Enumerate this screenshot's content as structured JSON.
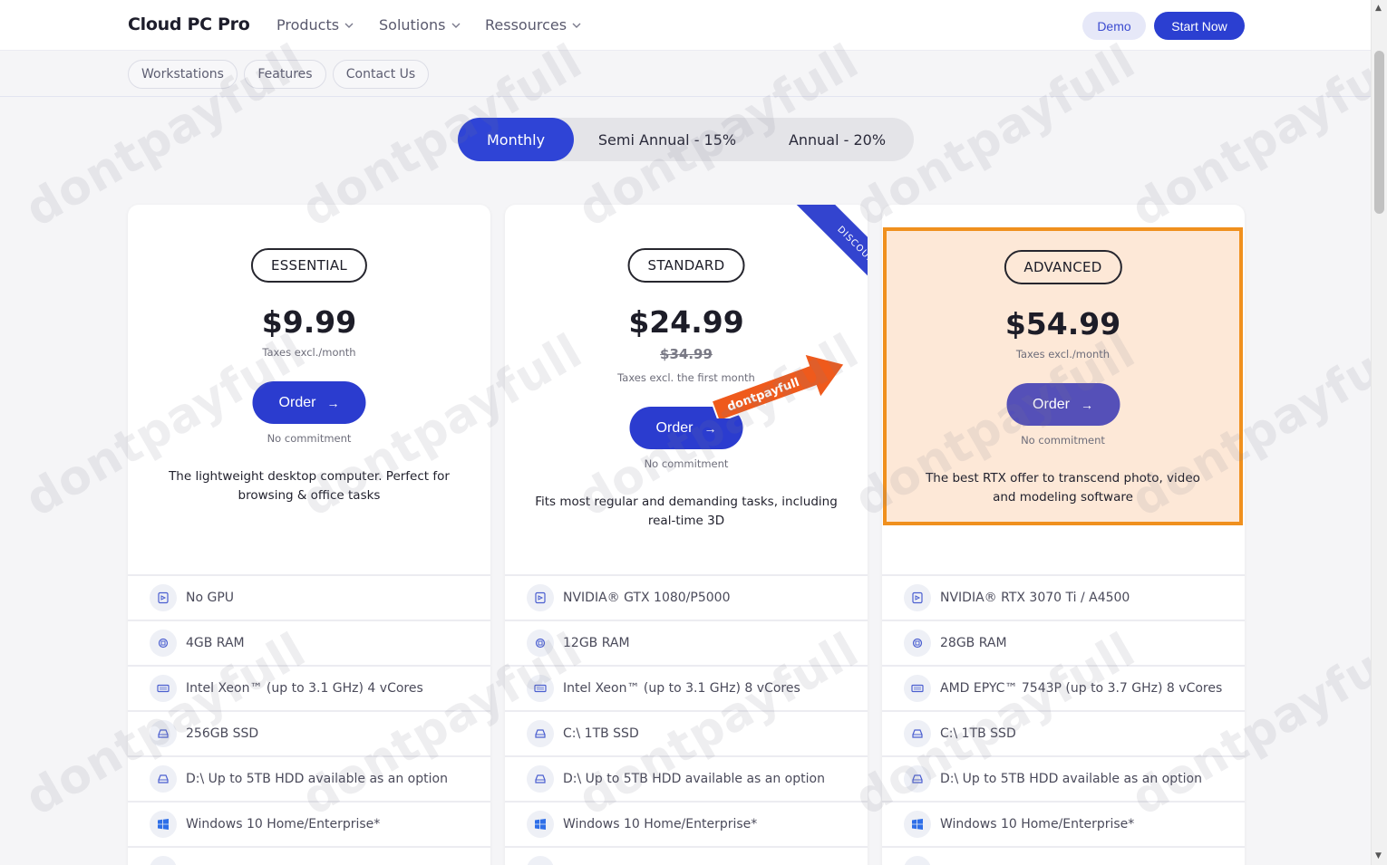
{
  "header": {
    "brand": "Cloud PC Pro",
    "nav": [
      "Products",
      "Solutions",
      "Ressources"
    ],
    "demo_label": "Demo",
    "start_label": "Start Now"
  },
  "subnav": [
    "Workstations",
    "Features",
    "Contact Us"
  ],
  "billing": {
    "options": [
      "Monthly",
      "Semi Annual - 15%",
      "Annual - 20%"
    ],
    "selected": "Monthly"
  },
  "plans": [
    {
      "name": "ESSENTIAL",
      "price": "$9.99",
      "taxes": "Taxes excl./month",
      "order_label": "Order",
      "commitment": "No commitment",
      "description": "The lightweight desktop computer. Perfect for browsing & office tasks",
      "features": [
        "No GPU",
        "4GB RAM",
        "Intel Xeon™ (up to 3.1 GHz) 4 vCores",
        "256GB SSD",
        "D:\\ Up to 5TB HDD available as an option",
        "Windows 10 Home/Enterprise*"
      ]
    },
    {
      "name": "STANDARD",
      "price": "$24.99",
      "old_price": "$34.99",
      "taxes": "Taxes excl. the first month",
      "ribbon": "DISCOUNT",
      "order_label": "Order",
      "commitment": "No commitment",
      "description": "Fits most regular and demanding tasks, including real-time 3D",
      "features": [
        "NVIDIA® GTX 1080/P5000",
        "12GB RAM",
        "Intel Xeon™ (up to 3.1 GHz) 8 vCores",
        "C:\\ 1TB SSD",
        "D:\\ Up to 5TB HDD available as an option",
        "Windows 10 Home/Enterprise*"
      ]
    },
    {
      "name": "ADVANCED",
      "price": "$54.99",
      "taxes": "Taxes excl./month",
      "order_label": "Order",
      "commitment": "No commitment",
      "description": "The best RTX offer to transcend photo, video and modeling software",
      "features": [
        "NVIDIA® RTX 3070 Ti / A4500",
        "28GB RAM",
        "AMD EPYC™ 7543P (up to 3.7 GHz) 8 vCores",
        "C:\\ 1TB SSD",
        "D:\\ Up to 5TB HDD available as an option",
        "Windows 10 Home/Enterprise*"
      ]
    }
  ],
  "overlay": {
    "arrow_text": "dontpayfull",
    "watermark": "dontpayfull"
  },
  "colors": {
    "accent": "#2b3ccf",
    "highlight_fill": "#fde8d7",
    "highlight_border": "#f0901e",
    "promo_arrow": "#ef5a1c"
  },
  "icons": [
    "gpu-icon",
    "ram-icon",
    "cpu-icon",
    "ssd-icon",
    "hdd-icon",
    "windows-icon"
  ]
}
